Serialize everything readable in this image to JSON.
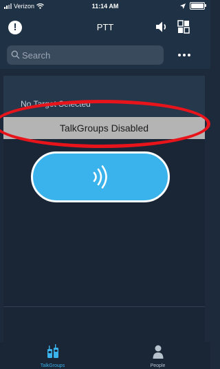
{
  "status_bar": {
    "carrier": "Verizon",
    "time": "11:14 AM"
  },
  "header": {
    "title": "PTT"
  },
  "search": {
    "placeholder": "Search",
    "value": ""
  },
  "target": {
    "text": "No Target Selected"
  },
  "banner": {
    "text": "TalkGroups Disabled"
  },
  "tabs": [
    {
      "label": "TalkGroups",
      "icon": "walkie-talkie-icon",
      "active": true
    },
    {
      "label": "People",
      "icon": "person-icon",
      "active": false
    }
  ],
  "colors": {
    "accent": "#3ab3ec",
    "annotation": "#e8141b",
    "active_tab": "#3ab3ec",
    "inactive_tab": "#b8c2cd"
  }
}
